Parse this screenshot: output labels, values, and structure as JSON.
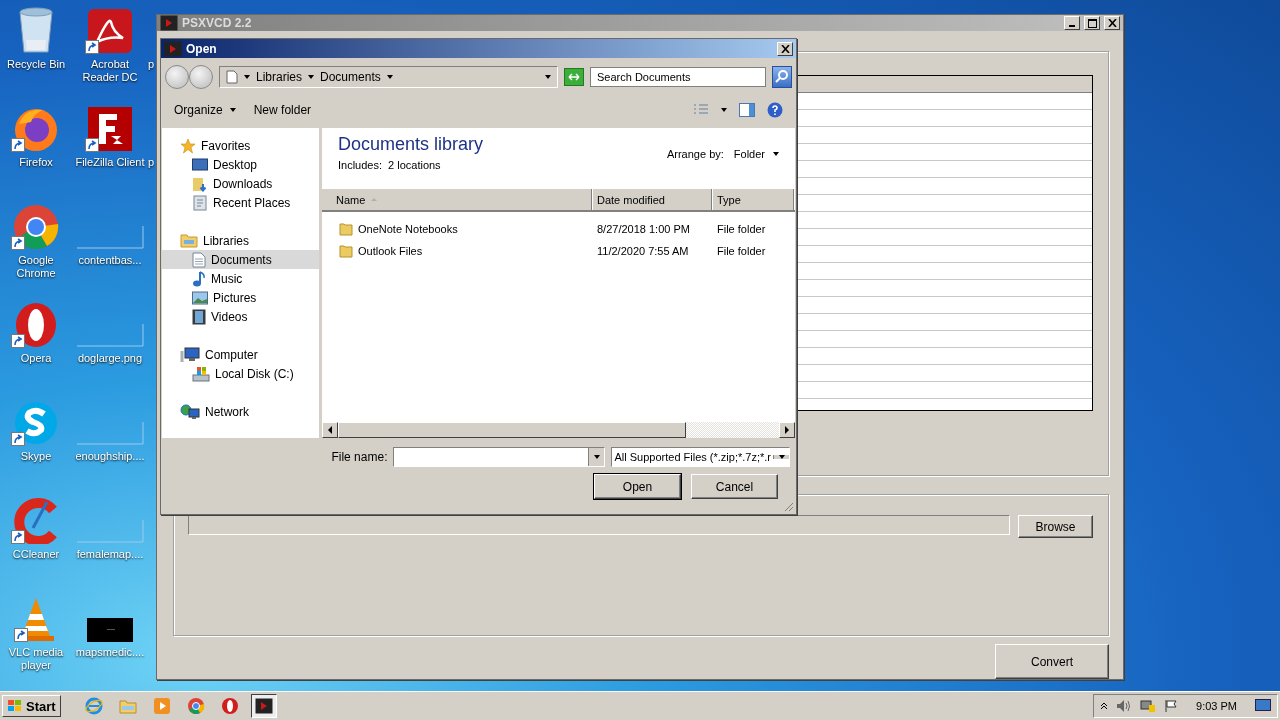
{
  "desktop": {
    "icons": [
      {
        "label": "Recycle Bin",
        "kind": "recycle",
        "shortcut": false
      },
      {
        "label": "Firefox",
        "kind": "firefox",
        "shortcut": true
      },
      {
        "label": "Google Chrome",
        "kind": "chrome",
        "shortcut": true
      },
      {
        "label": "Opera",
        "kind": "opera",
        "shortcut": true
      },
      {
        "label": "Skype",
        "kind": "skype",
        "shortcut": true
      },
      {
        "label": "CCleaner",
        "kind": "ccleaner",
        "shortcut": true
      },
      {
        "label": "VLC media player",
        "kind": "vlc",
        "shortcut": true
      },
      {
        "label": "Acrobat Reader DC",
        "kind": "acrobat",
        "shortcut": true
      },
      {
        "label": "FileZilla Client",
        "kind": "filezilla",
        "shortcut": true
      },
      {
        "label": "contentbas...",
        "kind": "thumb",
        "shortcut": false
      },
      {
        "label": "doglarge.png",
        "kind": "thumb",
        "shortcut": false
      },
      {
        "label": "enoughship....",
        "kind": "thumb",
        "shortcut": false
      },
      {
        "label": "femalemap....",
        "kind": "thumb",
        "shortcut": false
      },
      {
        "label": "mapsmedic....",
        "kind": "dark-thumb",
        "shortcut": false
      },
      {
        "label": "p",
        "kind": "covered"
      },
      {
        "label": "p",
        "kind": "covered"
      }
    ]
  },
  "main_window": {
    "title": "PSXVCD 2.2",
    "active": false,
    "buttons": [
      {
        "label": "Browse",
        "kind": "browse"
      },
      {
        "label": "Convert",
        "kind": "convert"
      }
    ]
  },
  "open_dialog": {
    "title": "Open",
    "active": true,
    "breadcrumb": [
      "Libraries",
      "Documents"
    ],
    "search": {
      "placeholder": "Search Documents"
    },
    "toolbar": [
      {
        "label": "Organize",
        "dropdown": true
      },
      {
        "label": "New folder",
        "dropdown": false
      }
    ],
    "nav": [
      {
        "label": "Favorites",
        "kind": "star",
        "selected": false,
        "children": [
          {
            "label": "Desktop",
            "kind": "desktop",
            "selected": false
          },
          {
            "label": "Downloads",
            "kind": "downloads",
            "selected": false
          },
          {
            "label": "Recent Places",
            "kind": "recent",
            "selected": false
          }
        ]
      },
      {
        "label": "Libraries",
        "kind": "libraries",
        "selected": false,
        "children": [
          {
            "label": "Documents",
            "kind": "document",
            "selected": true
          },
          {
            "label": "Music",
            "kind": "music",
            "selected": false
          },
          {
            "label": "Pictures",
            "kind": "pictures",
            "selected": false
          },
          {
            "label": "Videos",
            "kind": "videos",
            "selected": false
          }
        ]
      },
      {
        "label": "Computer",
        "kind": "computer",
        "selected": false,
        "children": [
          {
            "label": "Local Disk (C:)",
            "kind": "disk",
            "selected": false
          }
        ]
      },
      {
        "label": "Network",
        "kind": "network",
        "selected": false
      }
    ],
    "library": {
      "title": "Documents library",
      "includes_label": "Includes:",
      "locations": "2 locations",
      "arrange_label": "Arrange by:",
      "arrange_value": "Folder"
    },
    "columns": [
      {
        "label": "Name",
        "sorted": true
      },
      {
        "label": "Date modified",
        "sorted": false
      },
      {
        "label": "Type",
        "sorted": false
      }
    ],
    "rows": [
      {
        "name": "OneNote Notebooks",
        "date": "8/27/2018 1:00 PM",
        "type": "File folder",
        "selected": false
      },
      {
        "name": "Outlook Files",
        "date": "11/2/2020 7:55 AM",
        "type": "File folder",
        "selected": false
      }
    ],
    "file_name": {
      "label": "File name:"
    },
    "filter": {
      "value": "All Supported Files (*.zip;*.7z;*.r"
    },
    "buttons": [
      {
        "label": "Open",
        "default": true
      },
      {
        "label": "Cancel",
        "default": false
      }
    ]
  },
  "taskbar": {
    "start": "Start",
    "apps": [
      {
        "kind": "ie",
        "active": false
      },
      {
        "kind": "explorer",
        "active": false
      },
      {
        "kind": "media",
        "active": false
      },
      {
        "kind": "chrome",
        "active": false
      },
      {
        "kind": "opera",
        "active": false
      },
      {
        "kind": "psx",
        "active": true
      }
    ],
    "clock": "9:03 PM"
  }
}
